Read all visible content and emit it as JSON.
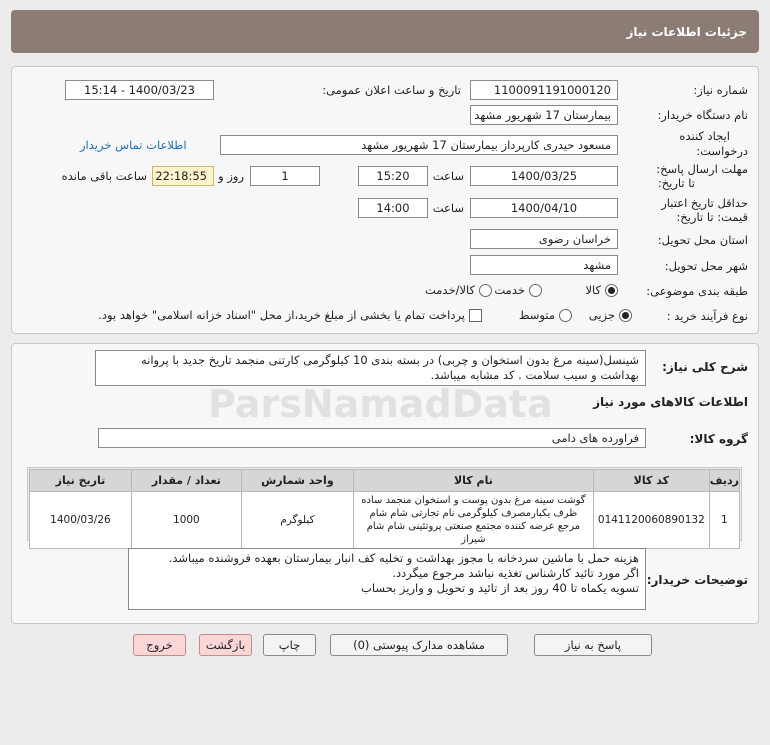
{
  "header": {
    "title": "جزئیات اطلاعات نیاز"
  },
  "info": {
    "need_number_label": "شماره نیاز:",
    "need_number": "1100091191000120",
    "announce_label": "تاریخ و ساعت اعلان عمومی:",
    "announce_value": "1400/03/23 - 15:14",
    "buyer_org_label": "نام دستگاه خریدار:",
    "buyer_org": "بیمارستان 17 شهریور مشهد",
    "requester_label_1": "ایجاد کننده",
    "requester_label_2": "درخواست:",
    "requester": "مسعود حیدری کارپرداز بیمارستان 17 شهریور مشهد",
    "contact_link": "اطلاعات تماس خریدار",
    "reply_label_1": "مهلت ارسال پاسخ:",
    "reply_label_2": "تا تاریخ:",
    "reply_date": "1400/03/25",
    "time_label": "ساعت",
    "reply_time": "15:20",
    "days_value": "1",
    "days_label": "روز و",
    "remaining_time": "22:18:55",
    "remaining_label": "ساعت باقی مانده",
    "validity_label_1": "حداقل تاریخ اعتبار",
    "validity_label_2": "قیمت: تا تاریخ:",
    "validity_date": "1400/04/10",
    "validity_time": "14:00",
    "province_label": "استان محل تحویل:",
    "province": "خراسان رضوی",
    "city_label": "شهر محل تحویل:",
    "city": "مشهد",
    "category_label": "طبقه بندی موضوعی:",
    "category_options": [
      "کالا",
      "خدمت",
      "کالا/خدمت"
    ],
    "process_label": "نوع فرآیند خرید :",
    "process_options": [
      "جزیی",
      "متوسط"
    ],
    "payment_note": "پرداخت تمام یا بخشی از مبلغ خرید،از محل \"اسناد خزانه اسلامی\" خواهد بود."
  },
  "description": {
    "label": "شرح کلی نیاز:",
    "text": "شینسل(سینه مرغ بدون استخوان و چربی) در بسته بندی 10 کیلوگرمی کارتنی منجمد تاریخ جدید با پروانه بهداشت و سیب سلامت . کد مشابه میباشد."
  },
  "goods": {
    "section_title": "اطلاعات کالاهای مورد نیاز",
    "group_label": "گروه کالا:",
    "group_value": "فراورده های دامی",
    "headers": [
      "ردیف",
      "کد کالا",
      "نام کالا",
      "واحد شمارش",
      "تعداد / مقدار",
      "تاریخ نیاز"
    ],
    "rows": [
      {
        "row": "1",
        "code": "0141120060890132",
        "name": "گوشت سینه مرغ بدون پوست و استخوان منجمد ساده ظرف یکبارمصرف کیلوگرمی نام تجارتی شام شام مرجع عرضه کننده مجتمع صنعتی پروتئینی شام شام شیراز",
        "unit": "کیلوگرم",
        "qty": "1000",
        "date": "1400/03/26"
      }
    ]
  },
  "buyer_notes": {
    "label": "توضیحات خریدار:",
    "lines": [
      "هزینه حمل با ماشین سردخانه با مجوز بهداشت و تخلیه کف انبار بیمارستان بعهده فروشنده میباشد.",
      "اگر مورد تائید کارشناس تغذیه نباشد مرجوع میگردد.",
      "تسویه یکماه تا 40 روز بعد از تائید و تحویل و واریز بحساب"
    ]
  },
  "buttons": {
    "reply": "پاسخ به نیاز",
    "attachments": "مشاهده مدارک پیوستی (0)",
    "print": "چاپ",
    "back": "بازگشت",
    "exit": "خروج"
  },
  "colors": {
    "header": "#8b7d73",
    "link": "#1a6fc4",
    "timer_bg": "#fbf4cc",
    "danger_bg": "#fbd6d6"
  }
}
